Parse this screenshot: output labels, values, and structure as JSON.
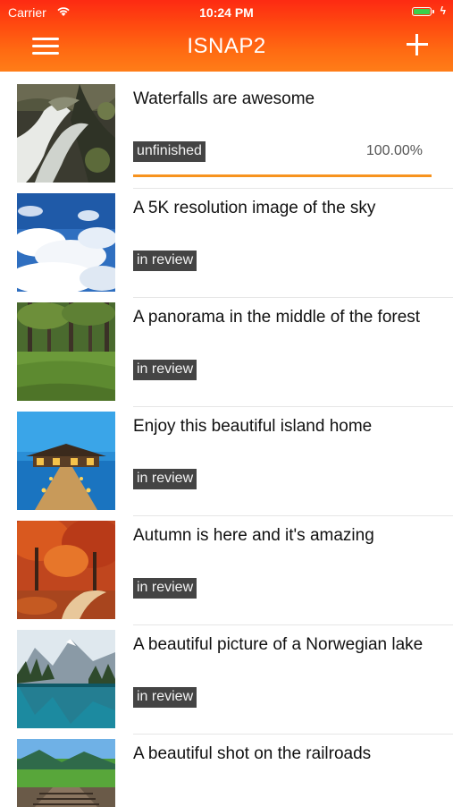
{
  "status_bar": {
    "carrier": "Carrier",
    "time": "10:24 PM"
  },
  "nav": {
    "title": "ISNAP2",
    "menu_icon": "hamburger-menu-icon",
    "add_icon": "plus-icon"
  },
  "colors": {
    "accent": "#f7931e",
    "header_top": "#fd2a12",
    "header_bottom": "#ff7d18",
    "badge_bg": "#444444"
  },
  "items": [
    {
      "title": "Waterfalls are awesome",
      "status": "unfinished",
      "progress_text": "100.00%",
      "progress": 1.0,
      "image": "waterfall-photo"
    },
    {
      "title": "A 5K resolution image of the sky",
      "status": "in review",
      "image": "sky-clouds-photo"
    },
    {
      "title": "A panorama in the middle of the forest",
      "status": "in review",
      "image": "forest-photo"
    },
    {
      "title": "Enjoy this beautiful island home",
      "status": "in review",
      "image": "island-home-photo"
    },
    {
      "title": "Autumn is here and it's amazing",
      "status": "in review",
      "image": "autumn-photo"
    },
    {
      "title": "A beautiful picture of a Norwegian lake",
      "status": "in review",
      "image": "norwegian-lake-photo"
    },
    {
      "title": "A beautiful shot on the railroads",
      "status": "",
      "image": "railroad-photo"
    }
  ]
}
